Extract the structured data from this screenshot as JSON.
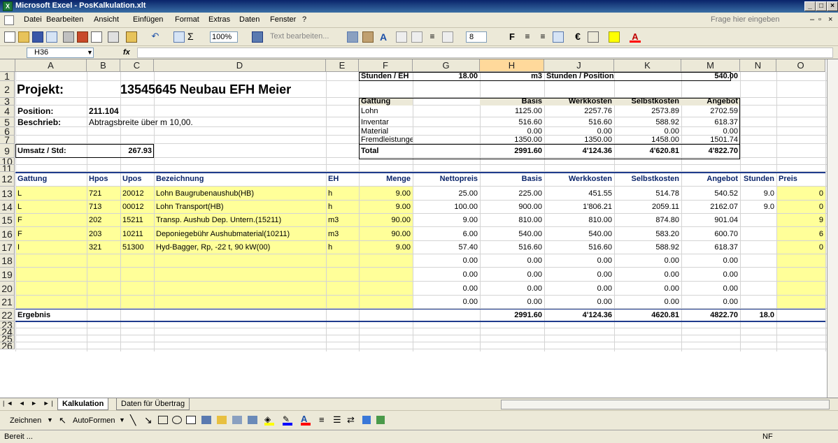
{
  "window": {
    "title": "Microsoft Excel - PosKalkulation.xlt"
  },
  "menu": {
    "items": [
      "Datei",
      "Bearbeiten",
      "Ansicht",
      "Einfügen",
      "Format",
      "Extras",
      "Daten",
      "Fenster",
      "?"
    ],
    "help_placeholder": "Frage hier eingeben"
  },
  "toolbar": {
    "zoom": "100%",
    "text_edit": "Text bearbeiten...",
    "font_size": "8",
    "bold": "F",
    "currency": "€",
    "sigma": "Σ"
  },
  "formula": {
    "namebox": "H36",
    "fx": "fx"
  },
  "columns": [
    "A",
    "B",
    "C",
    "D",
    "E",
    "F",
    "G",
    "H",
    "J",
    "K",
    "M",
    "N",
    "O"
  ],
  "rows": [
    "1",
    "2",
    "3",
    "4",
    "5",
    "6",
    "7",
    "9",
    "10",
    "11",
    "12",
    "13",
    "14",
    "15",
    "16",
    "17",
    "18",
    "19",
    "20",
    "21",
    "22",
    "23",
    "24",
    "25",
    "26"
  ],
  "header": {
    "project_label": "Projekt:",
    "project_value": "13545645 Neubau EFH Meier",
    "position_label": "Position:",
    "position_value": "211.104",
    "beschrieb_label": "Beschrieb:",
    "beschrieb_value": "Abtragsbreite über m 10,00.",
    "umsatz_label": "Umsatz / Std:",
    "umsatz_value": "267.93"
  },
  "summary": {
    "stunden_eh_label": "Stunden / EH",
    "stunden_eh_value": "18.00",
    "unit": "m3",
    "stunden_pos_label": "Stunden / Position",
    "stunden_pos_value": "540.00",
    "headers": [
      "Gattung",
      "Basis",
      "Werkkosten",
      "Selbstkosten",
      "Angebot"
    ],
    "rows": [
      {
        "gattung": "Lohn",
        "basis": "1125.00",
        "werk": "2257.76",
        "selbst": "2573.89",
        "angebot": "2702.59"
      },
      {
        "gattung": "Inventar",
        "basis": "516.60",
        "werk": "516.60",
        "selbst": "588.92",
        "angebot": "618.37"
      },
      {
        "gattung": "Material",
        "basis": "0.00",
        "werk": "0.00",
        "selbst": "0.00",
        "angebot": "0.00"
      },
      {
        "gattung": "Fremdleistungen",
        "basis": "1350.00",
        "werk": "1350.00",
        "selbst": "1458.00",
        "angebot": "1501.74"
      }
    ],
    "total": {
      "label": "Total",
      "basis": "2991.60",
      "werk": "4'124.36",
      "selbst": "4'620.81",
      "angebot": "4'822.70"
    }
  },
  "table": {
    "headers": [
      "Gattung",
      "Hpos",
      "Upos",
      "Bezeichnung",
      "EH",
      "Menge",
      "Nettopreis",
      "Basis",
      "Werkkosten",
      "Selbstkosten",
      "Angebot",
      "Stunden",
      "Preis"
    ],
    "rows": [
      {
        "gattung": "L",
        "hpos": "721",
        "upos": "20012",
        "bez": "Lohn Baugrubenaushub(HB)",
        "eh": "h",
        "menge": "9.00",
        "netto": "25.00",
        "basis": "225.00",
        "werk": "451.55",
        "selbst": "514.78",
        "angebot": "540.52",
        "stunden": "9.0",
        "preis": "0"
      },
      {
        "gattung": "L",
        "hpos": "713",
        "upos": "00012",
        "bez": "Lohn Transport(HB)",
        "eh": "h",
        "menge": "9.00",
        "netto": "100.00",
        "basis": "900.00",
        "werk": "1'806.21",
        "selbst": "2059.11",
        "angebot": "2162.07",
        "stunden": "9.0",
        "preis": "0"
      },
      {
        "gattung": "F",
        "hpos": "202",
        "upos": "15211",
        "bez": "Transp. Aushub Dep. Untern.(15211)",
        "eh": "m3",
        "menge": "90.00",
        "netto": "9.00",
        "basis": "810.00",
        "werk": "810.00",
        "selbst": "874.80",
        "angebot": "901.04",
        "stunden": "",
        "preis": "9"
      },
      {
        "gattung": "F",
        "hpos": "203",
        "upos": "10211",
        "bez": "Deponiegebühr Aushubmaterial(10211)",
        "eh": "m3",
        "menge": "90.00",
        "netto": "6.00",
        "basis": "540.00",
        "werk": "540.00",
        "selbst": "583.20",
        "angebot": "600.70",
        "stunden": "",
        "preis": "6"
      },
      {
        "gattung": "I",
        "hpos": "321",
        "upos": "51300",
        "bez": "Hyd-Bagger, Rp, -22 t, 90 kW(00)",
        "eh": "h",
        "menge": "9.00",
        "netto": "57.40",
        "basis": "516.60",
        "werk": "516.60",
        "selbst": "588.92",
        "angebot": "618.37",
        "stunden": "",
        "preis": "0"
      },
      {
        "gattung": "",
        "hpos": "",
        "upos": "",
        "bez": "",
        "eh": "",
        "menge": "",
        "netto": "0.00",
        "basis": "0.00",
        "werk": "0.00",
        "selbst": "0.00",
        "angebot": "0.00",
        "stunden": "",
        "preis": ""
      },
      {
        "gattung": "",
        "hpos": "",
        "upos": "",
        "bez": "",
        "eh": "",
        "menge": "",
        "netto": "0.00",
        "basis": "0.00",
        "werk": "0.00",
        "selbst": "0.00",
        "angebot": "0.00",
        "stunden": "",
        "preis": ""
      },
      {
        "gattung": "",
        "hpos": "",
        "upos": "",
        "bez": "",
        "eh": "",
        "menge": "",
        "netto": "0.00",
        "basis": "0.00",
        "werk": "0.00",
        "selbst": "0.00",
        "angebot": "0.00",
        "stunden": "",
        "preis": ""
      },
      {
        "gattung": "",
        "hpos": "",
        "upos": "",
        "bez": "",
        "eh": "",
        "menge": "",
        "netto": "0.00",
        "basis": "0.00",
        "werk": "0.00",
        "selbst": "0.00",
        "angebot": "0.00",
        "stunden": "",
        "preis": ""
      }
    ],
    "result": {
      "label": "Ergebnis",
      "basis": "2991.60",
      "werk": "4'124.36",
      "selbst": "4620.81",
      "angebot": "4822.70",
      "stunden": "18.0"
    }
  },
  "sheets": {
    "tabs": [
      "Kalkulation",
      "Daten für Übertrag"
    ]
  },
  "draw": {
    "zeichnen": "Zeichnen",
    "autoformen": "AutoFormen"
  },
  "status": {
    "ready": "Bereit ...",
    "nf": "NF"
  },
  "colors": {
    "input_yellow": "#ffff99",
    "header_gray": "#ece9d8",
    "selected_col": "#ffd99b",
    "title_blue": "#0a246a",
    "table_border": "#1f3b8c"
  }
}
